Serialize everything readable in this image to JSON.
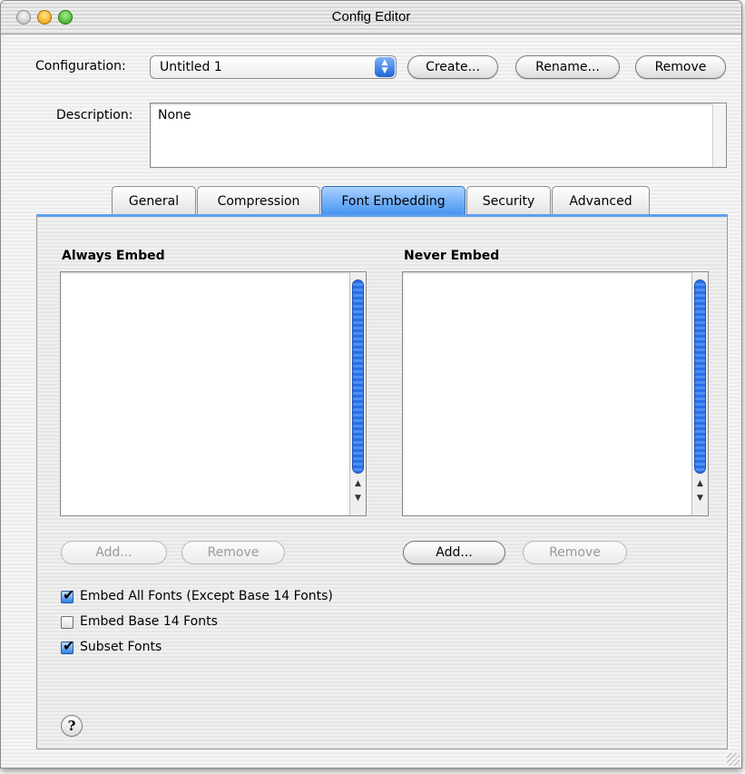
{
  "window": {
    "title": "Config Editor"
  },
  "configuration": {
    "label": "Configuration:",
    "selected": "Untitled 1",
    "create_label": "Create...",
    "rename_label": "Rename...",
    "remove_label": "Remove"
  },
  "description": {
    "label": "Description:",
    "value": "None"
  },
  "tabs": [
    {
      "label": "General",
      "active": false
    },
    {
      "label": "Compression",
      "active": false
    },
    {
      "label": "Font Embedding",
      "active": true
    },
    {
      "label": "Security",
      "active": false
    },
    {
      "label": "Advanced",
      "active": false
    }
  ],
  "always_embed": {
    "title": "Always Embed",
    "add_label": "Add...",
    "remove_label": "Remove",
    "add_enabled": false,
    "remove_enabled": false
  },
  "never_embed": {
    "title": "Never Embed",
    "add_label": "Add...",
    "remove_label": "Remove",
    "add_enabled": true,
    "remove_enabled": false
  },
  "options": [
    {
      "label": "Embed All Fonts (Except Base 14 Fonts)",
      "checked": true
    },
    {
      "label": "Embed Base 14 Fonts",
      "checked": false
    },
    {
      "label": "Subset Fonts",
      "checked": true
    }
  ],
  "help": {
    "glyph": "?"
  },
  "colors": {
    "accent": "#3f8ef0",
    "scroll_thumb": "#2a6fe6"
  }
}
